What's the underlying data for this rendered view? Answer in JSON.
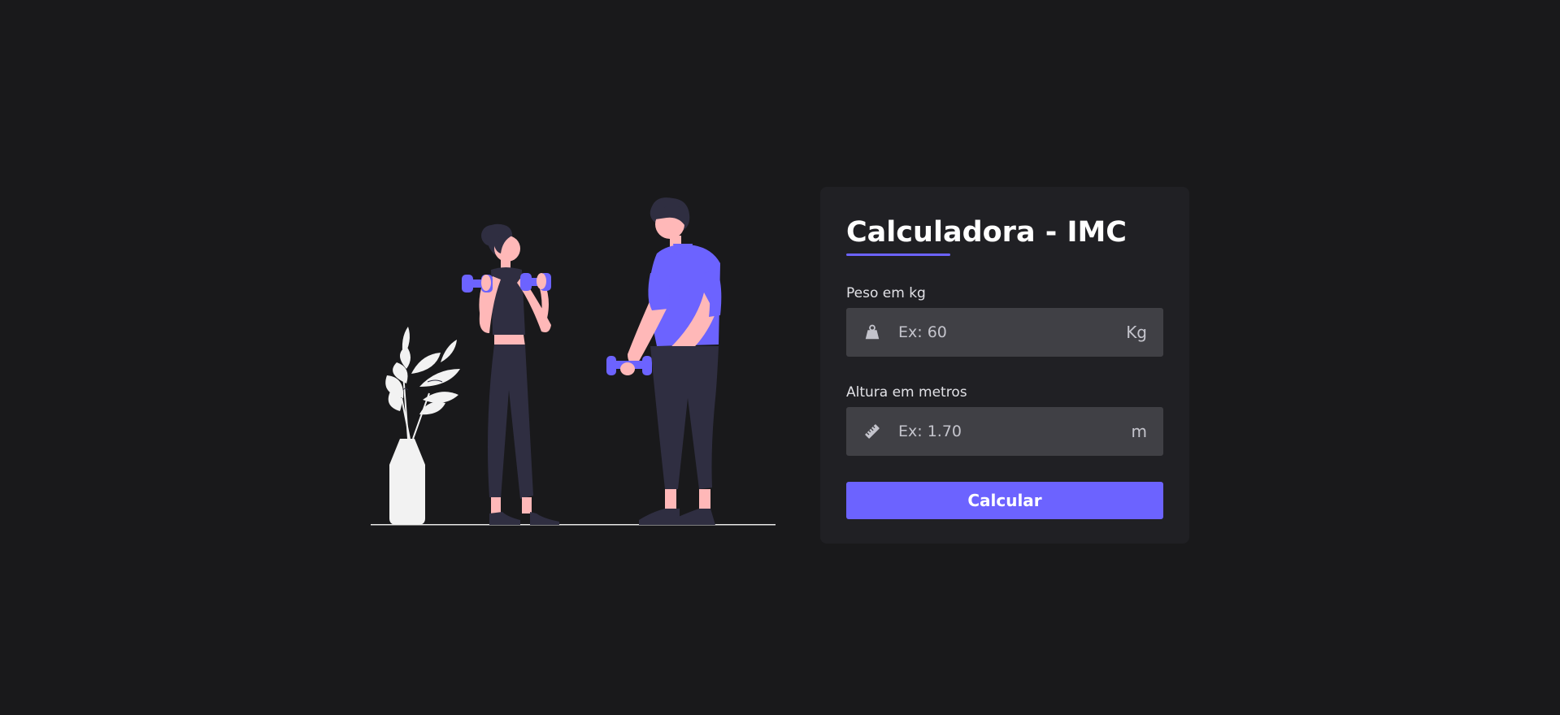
{
  "form": {
    "title": "Calculadora - IMC",
    "weight": {
      "label": "Peso em kg",
      "placeholder": "Ex: 60",
      "value": "",
      "unit": "Kg",
      "icon": "weight-icon"
    },
    "height": {
      "label": "Altura em metros",
      "placeholder": "Ex: 1.70",
      "value": "",
      "unit": "m",
      "icon": "ruler-icon"
    },
    "submit_label": "Calcular"
  },
  "colors": {
    "background": "#19191b",
    "card": "#202024",
    "input": "#404045",
    "accent": "#6c63ff",
    "skin": "#ffb8b8",
    "dark": "#2f2e41",
    "plant": "#f2f2f2"
  }
}
